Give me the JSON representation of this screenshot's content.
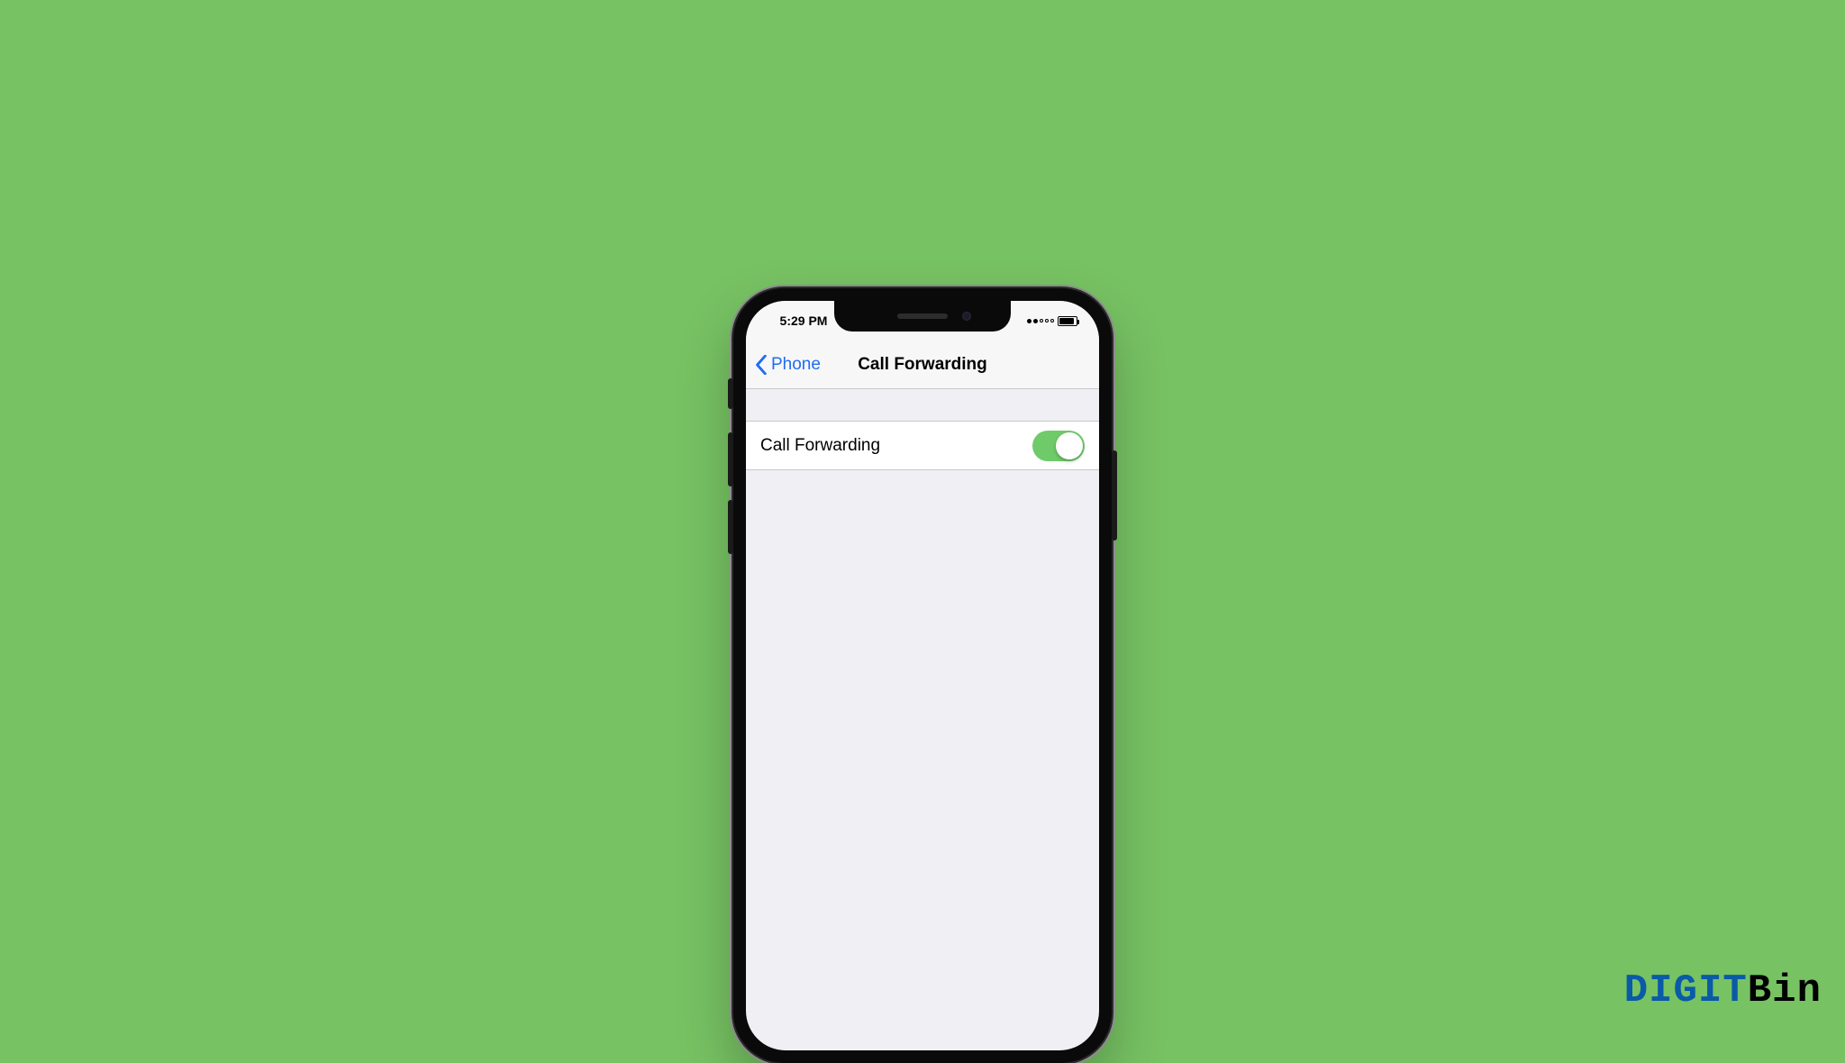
{
  "statusbar": {
    "time": "5:29 PM"
  },
  "navbar": {
    "back_label": "Phone",
    "title": "Call Forwarding"
  },
  "settings": {
    "call_forwarding_label": "Call Forwarding",
    "call_forwarding_on": true
  },
  "watermark": {
    "part1": "DIGIT",
    "part2": "Bin"
  },
  "colors": {
    "page_bg": "#77c263",
    "ios_link": "#1f6df2",
    "toggle_on": "#6fcb6a"
  }
}
